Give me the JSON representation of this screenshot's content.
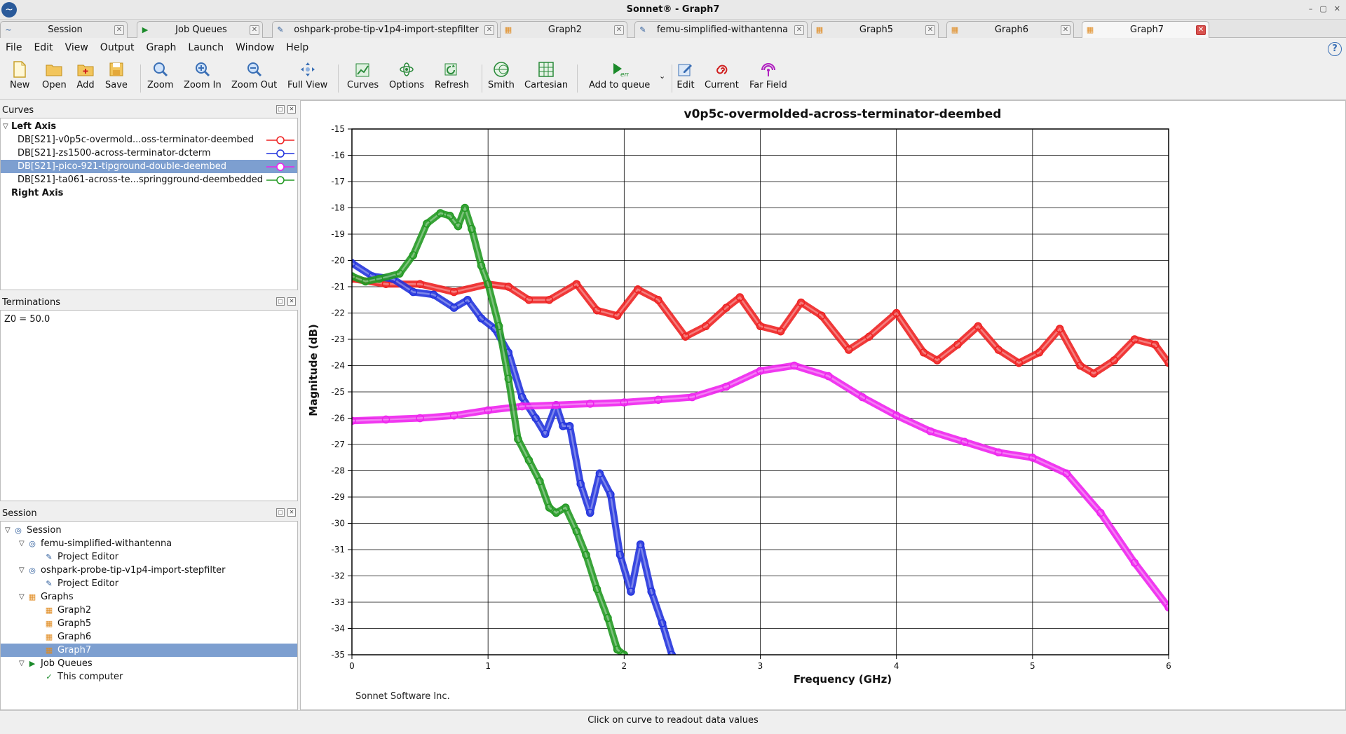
{
  "window": {
    "title": "Sonnet® - Graph7"
  },
  "tabs": [
    {
      "label": "Session",
      "icon": "session-icon"
    },
    {
      "label": "Job Queues",
      "icon": "em-icon"
    },
    {
      "label": "oshpark-probe-tip-v1p4-import-stepfilter",
      "icon": "project-icon"
    },
    {
      "label": "Graph2",
      "icon": "graph-icon"
    },
    {
      "label": "femu-simplified-withantenna",
      "icon": "project-icon"
    },
    {
      "label": "Graph5",
      "icon": "graph-icon"
    },
    {
      "label": "Graph6",
      "icon": "graph-icon"
    },
    {
      "label": "Graph7",
      "icon": "graph-icon",
      "active": true
    }
  ],
  "menu": {
    "file": "File",
    "edit": "Edit",
    "view": "View",
    "output": "Output",
    "graph": "Graph",
    "launch": "Launch",
    "window": "Window",
    "help": "Help"
  },
  "toolbar": {
    "new": "New",
    "open": "Open",
    "add": "Add",
    "save": "Save",
    "zoom": "Zoom",
    "zoom_in": "Zoom In",
    "zoom_out": "Zoom Out",
    "full_view": "Full View",
    "curves": "Curves",
    "options": "Options",
    "refresh": "Refresh",
    "smith": "Smith",
    "cartesian": "Cartesian",
    "add_to_queue": "Add to queue",
    "edit": "Edit",
    "current": "Current",
    "far_field": "Far Field"
  },
  "curves_panel": {
    "title": "Curves",
    "left_axis": "Left Axis",
    "right_axis": "Right Axis",
    "items": [
      {
        "label": "DB[S21]-v0p5c-overmold...oss-terminator-deembed",
        "color": "#ee2222"
      },
      {
        "label": "DB[S21]-zs1500-across-terminator-dcterm",
        "color": "#2233dd"
      },
      {
        "label": "DB[S21]-pico-921-tipground-double-deembed",
        "color": "#ee22ee",
        "selected": true
      },
      {
        "label": "DB[S21]-ta061-across-te...springground-deembedded",
        "color": "#229922"
      }
    ]
  },
  "terminations_panel": {
    "title": "Terminations",
    "text": "Z0 = 50.0"
  },
  "session_panel": {
    "title": "Session",
    "items": [
      {
        "label": "Session",
        "level": 0,
        "icon": "session-icon"
      },
      {
        "label": "femu-simplified-withantenna",
        "level": 1,
        "icon": "session-icon"
      },
      {
        "label": "Project Editor",
        "level": 2,
        "icon": "project-icon"
      },
      {
        "label": "oshpark-probe-tip-v1p4-import-stepfilter",
        "level": 1,
        "icon": "session-icon"
      },
      {
        "label": "Project Editor",
        "level": 2,
        "icon": "project-icon"
      },
      {
        "label": "Graphs",
        "level": 1,
        "icon": "graph-icon"
      },
      {
        "label": "Graph2",
        "level": 2,
        "icon": "graph-icon"
      },
      {
        "label": "Graph5",
        "level": 2,
        "icon": "graph-icon"
      },
      {
        "label": "Graph6",
        "level": 2,
        "icon": "graph-icon"
      },
      {
        "label": "Graph7",
        "level": 2,
        "icon": "graph-icon",
        "selected": true
      },
      {
        "label": "Job Queues",
        "level": 1,
        "icon": "em-icon"
      },
      {
        "label": "This computer",
        "level": 2,
        "icon": "check-icon"
      }
    ]
  },
  "graph": {
    "footer": "Sonnet Software Inc."
  },
  "chart_data": {
    "type": "line",
    "title": "v0p5c-overmolded-across-terminator-deembed",
    "xlabel": "Frequency (GHz)",
    "ylabel": "Magnitude (dB)",
    "xlim": [
      0,
      6
    ],
    "ylim": [
      -35,
      -15
    ],
    "xticks": [
      0,
      1,
      2,
      3,
      4,
      5,
      6
    ],
    "yticks": [
      -15,
      -16,
      -17,
      -18,
      -19,
      -20,
      -21,
      -22,
      -23,
      -24,
      -25,
      -26,
      -27,
      -28,
      -29,
      -30,
      -31,
      -32,
      -33,
      -34,
      -35
    ],
    "grid": true,
    "series": [
      {
        "name": "DB[S21]-v0p5c-overmold...oss-terminator-deembed",
        "color": "#ee2222",
        "x": [
          0,
          0.25,
          0.5,
          0.75,
          1.0,
          1.15,
          1.3,
          1.45,
          1.65,
          1.8,
          1.95,
          2.1,
          2.25,
          2.45,
          2.6,
          2.75,
          2.85,
          3.0,
          3.15,
          3.3,
          3.45,
          3.65,
          3.8,
          4.0,
          4.2,
          4.3,
          4.45,
          4.6,
          4.75,
          4.9,
          5.05,
          5.2,
          5.35,
          5.45,
          5.6,
          5.75,
          5.9,
          6.0
        ],
        "y": [
          -20.7,
          -20.9,
          -20.9,
          -21.2,
          -20.9,
          -21.0,
          -21.5,
          -21.5,
          -20.9,
          -21.9,
          -22.1,
          -21.1,
          -21.5,
          -22.9,
          -22.5,
          -21.8,
          -21.4,
          -22.5,
          -22.7,
          -21.6,
          -22.1,
          -23.4,
          -22.9,
          -22.0,
          -23.5,
          -23.8,
          -23.2,
          -22.5,
          -23.4,
          -23.9,
          -23.5,
          -22.6,
          -24.0,
          -24.3,
          -23.8,
          -23.0,
          -23.2,
          -23.9
        ]
      },
      {
        "name": "DB[S21]-zs1500-across-terminator-dcterm",
        "color": "#2233dd",
        "x": [
          0,
          0.15,
          0.3,
          0.45,
          0.6,
          0.75,
          0.85,
          0.95,
          1.05,
          1.15,
          1.25,
          1.35,
          1.42,
          1.5,
          1.55,
          1.6,
          1.68,
          1.75,
          1.82,
          1.9,
          1.97,
          2.05,
          2.12,
          2.2,
          2.28,
          2.35
        ],
        "y": [
          -20.1,
          -20.6,
          -20.7,
          -21.2,
          -21.3,
          -21.8,
          -21.5,
          -22.2,
          -22.6,
          -23.5,
          -25.2,
          -26.0,
          -26.6,
          -25.5,
          -26.3,
          -26.3,
          -28.5,
          -29.6,
          -28.1,
          -28.9,
          -31.2,
          -32.6,
          -30.8,
          -32.6,
          -33.8,
          -35
        ]
      },
      {
        "name": "DB[S21]-pico-921-tipground-double-deembed",
        "color": "#ee22ee",
        "x": [
          0,
          0.25,
          0.5,
          0.75,
          1.0,
          1.25,
          1.5,
          1.75,
          2.0,
          2.25,
          2.5,
          2.75,
          3.0,
          3.25,
          3.5,
          3.75,
          4.0,
          4.25,
          4.5,
          4.75,
          5.0,
          5.25,
          5.5,
          5.75,
          6.0
        ],
        "y": [
          -26.1,
          -26.05,
          -26.0,
          -25.9,
          -25.7,
          -25.55,
          -25.5,
          -25.45,
          -25.4,
          -25.3,
          -25.2,
          -24.8,
          -24.2,
          -24.0,
          -24.4,
          -25.2,
          -25.9,
          -26.5,
          -26.9,
          -27.3,
          -27.5,
          -28.1,
          -29.6,
          -31.5,
          -33.2
        ]
      },
      {
        "name": "DB[S21]-ta061-across-te...springground-deembedded",
        "color": "#229922",
        "x": [
          0,
          0.1,
          0.2,
          0.35,
          0.45,
          0.55,
          0.65,
          0.72,
          0.78,
          0.83,
          0.88,
          0.95,
          1.0,
          1.08,
          1.15,
          1.22,
          1.3,
          1.38,
          1.45,
          1.5,
          1.57,
          1.65,
          1.72,
          1.8,
          1.88,
          1.95,
          2.0
        ],
        "y": [
          -20.6,
          -20.8,
          -20.7,
          -20.5,
          -19.8,
          -18.6,
          -18.2,
          -18.3,
          -18.7,
          -18.0,
          -18.8,
          -20.2,
          -20.9,
          -22.5,
          -24.5,
          -26.8,
          -27.6,
          -28.4,
          -29.4,
          -29.6,
          -29.4,
          -30.3,
          -31.2,
          -32.5,
          -33.6,
          -34.8,
          -35.0
        ]
      }
    ]
  },
  "status": {
    "text": "Click on curve to readout data values"
  }
}
